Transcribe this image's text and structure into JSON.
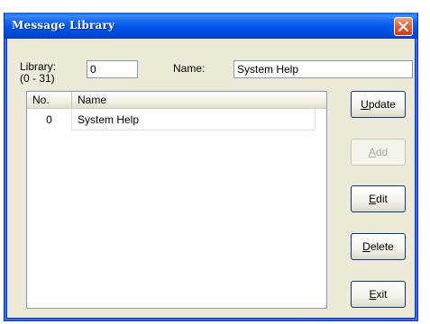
{
  "window": {
    "title": "Message Library"
  },
  "form": {
    "library_label_line1": "Library:",
    "library_label_line2": "(0 - 31)",
    "library_value": "0",
    "name_label": "Name:",
    "name_value": "System Help"
  },
  "list": {
    "columns": {
      "no": "No.",
      "name": "Name"
    },
    "rows": [
      {
        "no": "0",
        "name": "System Help"
      }
    ]
  },
  "buttons": [
    {
      "key": "U",
      "rest": "pdate",
      "enabled": true
    },
    {
      "key": "A",
      "rest": "dd",
      "enabled": false
    },
    {
      "key": "E",
      "rest": "dit",
      "enabled": true
    },
    {
      "key": "D",
      "rest": "elete",
      "enabled": true
    },
    {
      "key": "E",
      "rest": "xit",
      "enabled": true
    }
  ],
  "colors": {
    "titlebar": "#0058ee",
    "close": "#e2613b",
    "face": "#ece9d8"
  }
}
